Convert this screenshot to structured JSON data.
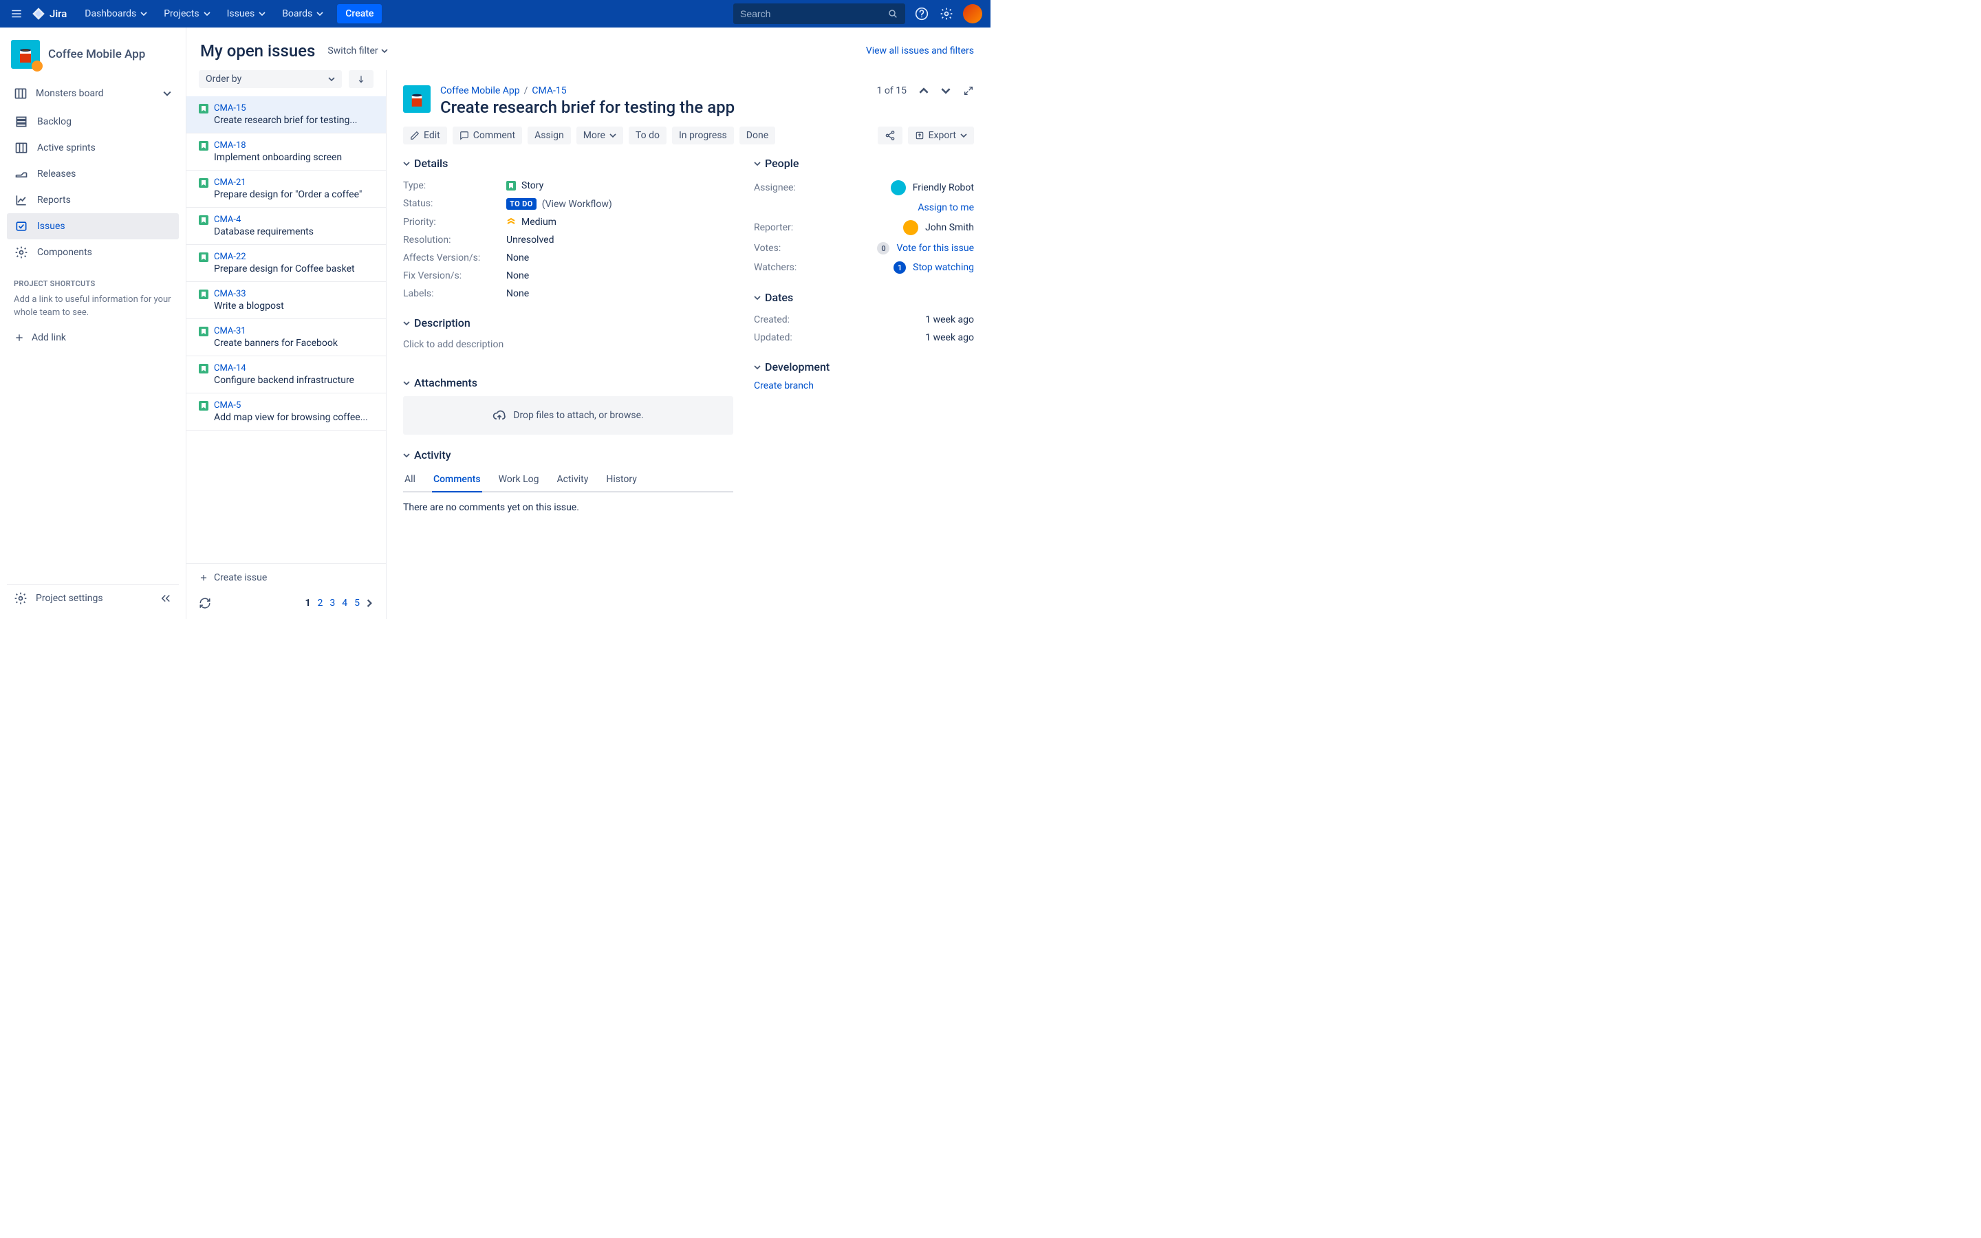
{
  "header": {
    "product": "Jira",
    "nav": [
      "Dashboards",
      "Projects",
      "Issues",
      "Boards"
    ],
    "create": "Create",
    "search_placeholder": "Search"
  },
  "project": {
    "name": "Coffee Mobile App"
  },
  "sidebar": {
    "board_group": "Monsters board",
    "items": [
      {
        "label": "Backlog"
      },
      {
        "label": "Active sprints"
      },
      {
        "label": "Releases"
      },
      {
        "label": "Reports"
      },
      {
        "label": "Issues"
      },
      {
        "label": "Components"
      }
    ],
    "shortcuts_title": "PROJECT SHORTCUTS",
    "shortcuts_hint": "Add a link to useful information for your whole team to see.",
    "add_link": "Add link",
    "settings": "Project settings"
  },
  "queue": {
    "title": "My open issues",
    "switch_filter": "Switch filter",
    "view_all": "View all issues and filters",
    "order_by": "Order by",
    "issues": [
      {
        "key": "CMA-15",
        "summary": "Create research brief for testing..."
      },
      {
        "key": "CMA-18",
        "summary": "Implement onboarding screen"
      },
      {
        "key": "CMA-21",
        "summary": "Prepare design for \"Order a coffee\""
      },
      {
        "key": "CMA-4",
        "summary": "Database requirements"
      },
      {
        "key": "CMA-22",
        "summary": "Prepare design for Coffee basket"
      },
      {
        "key": "CMA-33",
        "summary": "Write a blogpost"
      },
      {
        "key": "CMA-31",
        "summary": "Create banners for Facebook"
      },
      {
        "key": "CMA-14",
        "summary": "Configure backend infrastructure"
      },
      {
        "key": "CMA-5",
        "summary": "Add map view for browsing coffee..."
      }
    ],
    "create_issue": "Create issue",
    "pages": [
      "1",
      "2",
      "3",
      "4",
      "5"
    ]
  },
  "detail": {
    "breadcrumb_project": "Coffee Mobile App",
    "breadcrumb_key": "CMA-15",
    "title": "Create research brief for testing the app",
    "paging": "1 of 15",
    "toolbar": {
      "edit": "Edit",
      "comment": "Comment",
      "assign": "Assign",
      "more": "More",
      "todo": "To do",
      "inprogress": "In progress",
      "done": "Done",
      "export": "Export"
    },
    "panels": {
      "details": "Details",
      "description": "Description",
      "attachments": "Attachments",
      "activity": "Activity",
      "people": "People",
      "dates": "Dates",
      "development": "Development"
    },
    "fields": {
      "type_label": "Type:",
      "type_value": "Story",
      "status_label": "Status:",
      "status_lozenge": "TO DO",
      "status_view_workflow": "(View Workflow)",
      "priority_label": "Priority:",
      "priority_value": "Medium",
      "resolution_label": "Resolution:",
      "resolution_value": "Unresolved",
      "affects_label": "Affects Version/s:",
      "affects_value": "None",
      "fix_label": "Fix Version/s:",
      "fix_value": "None",
      "labels_label": "Labels:",
      "labels_value": "None"
    },
    "description_placeholder": "Click to add description",
    "attach_placeholder": "Drop files to attach, or browse.",
    "activity_tabs": [
      "All",
      "Comments",
      "Work Log",
      "Activity",
      "History"
    ],
    "no_comments": "There are no comments yet on this issue.",
    "people": {
      "assignee_label": "Assignee:",
      "assignee_name": "Friendly Robot",
      "assign_to_me": "Assign to me",
      "reporter_label": "Reporter:",
      "reporter_name": "John Smith",
      "votes_label": "Votes:",
      "votes_count": "0",
      "vote_link": "Vote for this issue",
      "watchers_label": "Watchers:",
      "watchers_count": "1",
      "watch_link": "Stop watching"
    },
    "dates": {
      "created_label": "Created:",
      "created_value": "1 week ago",
      "updated_label": "Updated:",
      "updated_value": "1 week ago"
    },
    "dev": {
      "create_branch": "Create branch"
    }
  }
}
